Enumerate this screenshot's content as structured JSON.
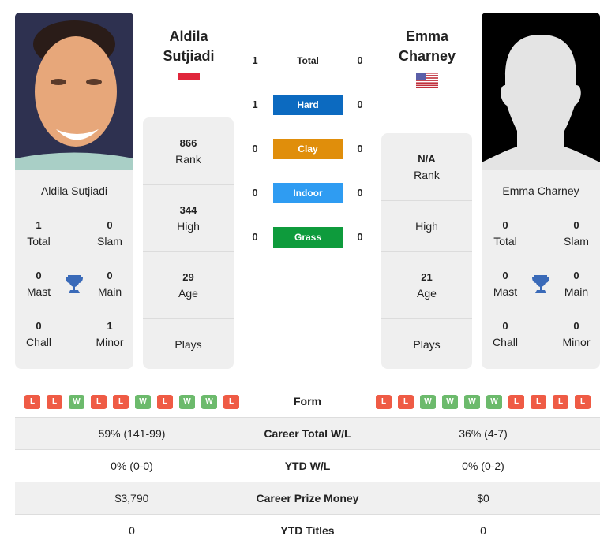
{
  "colors": {
    "hard": "#0c6ac0",
    "clay": "#e08e0b",
    "indoor": "#2f9cf2",
    "grass": "#0e9b3c",
    "loss": "#ef5b45",
    "win": "#6cba6c",
    "trophy": "#3a6ab8"
  },
  "player1": {
    "name_line1": "Aldila",
    "name_line2": "Sutjiadi",
    "full_name": "Aldila Sutjiadi",
    "flag": "indonesia-flag",
    "rank": "866",
    "rank_label": "Rank",
    "high": "344",
    "high_label": "High",
    "age": "29",
    "age_label": "Age",
    "plays_label": "Plays",
    "titles": {
      "total": "1",
      "total_label": "Total",
      "slam": "0",
      "slam_label": "Slam",
      "mast": "0",
      "mast_label": "Mast",
      "main": "0",
      "main_label": "Main",
      "chall": "0",
      "chall_label": "Chall",
      "minor": "1",
      "minor_label": "Minor"
    },
    "form": [
      "L",
      "L",
      "W",
      "L",
      "L",
      "W",
      "L",
      "W",
      "W",
      "L"
    ]
  },
  "player2": {
    "name_line1": "Emma",
    "name_line2": "Charney",
    "full_name": "Emma Charney",
    "flag": "usa-flag",
    "rank": "N/A",
    "rank_label": "Rank",
    "high": "",
    "high_label": "High",
    "age": "21",
    "age_label": "Age",
    "plays_label": "Plays",
    "titles": {
      "total": "0",
      "total_label": "Total",
      "slam": "0",
      "slam_label": "Slam",
      "mast": "0",
      "mast_label": "Mast",
      "main": "0",
      "main_label": "Main",
      "chall": "0",
      "chall_label": "Chall",
      "minor": "0",
      "minor_label": "Minor"
    },
    "form": [
      "L",
      "L",
      "W",
      "W",
      "W",
      "W",
      "L",
      "L",
      "L",
      "L"
    ]
  },
  "h2h": [
    {
      "label": "Total",
      "left": "1",
      "right": "0",
      "key": "total"
    },
    {
      "label": "Hard",
      "left": "1",
      "right": "0",
      "key": "hard"
    },
    {
      "label": "Clay",
      "left": "0",
      "right": "0",
      "key": "clay"
    },
    {
      "label": "Indoor",
      "left": "0",
      "right": "0",
      "key": "indoor"
    },
    {
      "label": "Grass",
      "left": "0",
      "right": "0",
      "key": "grass"
    }
  ],
  "table": {
    "form_label": "Form",
    "rows": [
      {
        "label": "Career Total W/L",
        "left": "59% (141-99)",
        "right": "36% (4-7)"
      },
      {
        "label": "YTD W/L",
        "left": "0% (0-0)",
        "right": "0% (0-2)"
      },
      {
        "label": "Career Prize Money",
        "left": "$3,790",
        "right": "$0"
      },
      {
        "label": "YTD Titles",
        "left": "0",
        "right": "0"
      }
    ]
  }
}
